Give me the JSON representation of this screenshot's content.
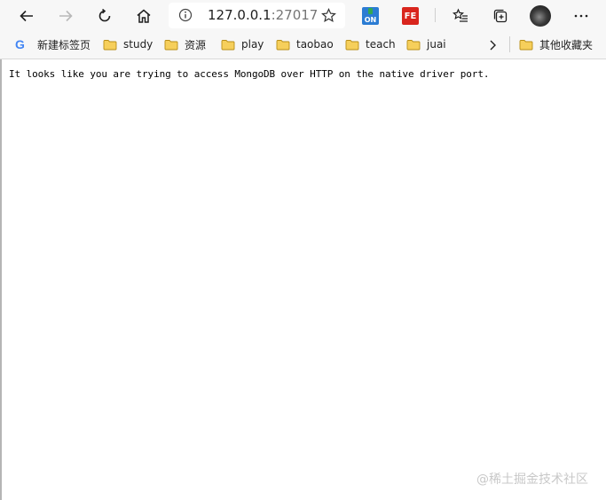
{
  "browser": {
    "address": {
      "host": "127.0.0.1",
      "port": ":27017"
    },
    "toolbar_icons": [
      "back-arrow-icon",
      "forward-arrow-icon",
      "refresh-icon",
      "home-icon",
      "info-icon",
      "star-icon",
      "favorites-icon",
      "collections-icon",
      "profile-avatar",
      "more-icon"
    ],
    "extensions": [
      {
        "name": "on-extension-icon",
        "label": "ON",
        "color": "#2b7cd3"
      },
      {
        "name": "fe-extension-icon",
        "label": "FE",
        "color": "#d9251d"
      }
    ]
  },
  "bookmarks": {
    "items": [
      {
        "label": "新建标签页",
        "icon": "google-icon"
      },
      {
        "label": "study",
        "icon": "folder-icon"
      },
      {
        "label": "资源",
        "icon": "folder-icon"
      },
      {
        "label": "play",
        "icon": "folder-icon"
      },
      {
        "label": "taobao",
        "icon": "folder-icon"
      },
      {
        "label": "teach",
        "icon": "folder-icon"
      },
      {
        "label": "juai",
        "icon": "folder-icon"
      }
    ],
    "other_label": "其他收藏夹",
    "folder_color": "#f4c04b"
  },
  "page": {
    "message": "It looks like you are trying to access MongoDB over HTTP on the native driver port."
  },
  "watermark": "@稀土掘金技术社区"
}
